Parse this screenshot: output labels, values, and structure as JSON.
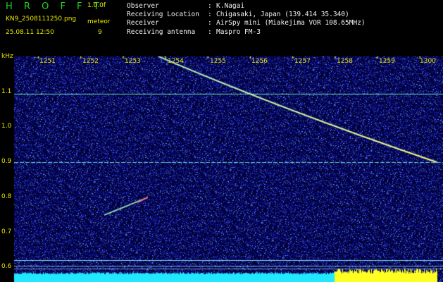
{
  "header": {
    "logo": "H R O F F T",
    "version": "1.0.0f",
    "filename": "KN9_2508111250.png",
    "meteor_label": "meteor",
    "timestamp": "25.08.11 12:50",
    "meteor_count": "9",
    "info": [
      {
        "key": "Observer",
        "value": "K.Nagai"
      },
      {
        "key": "Receiving Location",
        "value": "Chigasaki, Japan (139.414 35.340)"
      },
      {
        "key": "Receiver",
        "value": "AirSpy mini (Miakejima VOR 108.65MHz)"
      },
      {
        "key": "Receiving antenna",
        "value": "Maspro FM-3"
      }
    ]
  },
  "time_axis": {
    "labels": [
      "1251",
      "1252",
      "1253",
      "1254",
      "1255",
      "1256",
      "1257",
      "1258",
      "1259",
      "1300"
    ]
  },
  "freq_axis": {
    "unit": "kHz",
    "labels": [
      "1.1",
      "1.0",
      "0.9",
      "0.8",
      "0.7",
      "0.6"
    ]
  },
  "colors": {
    "background_noise": "#0a0a8a",
    "label_yellow": "#e8e800",
    "logo_green": "#21d321",
    "strip_cyan": "#22e8ff",
    "strip_yellow": "#ffff22"
  }
}
